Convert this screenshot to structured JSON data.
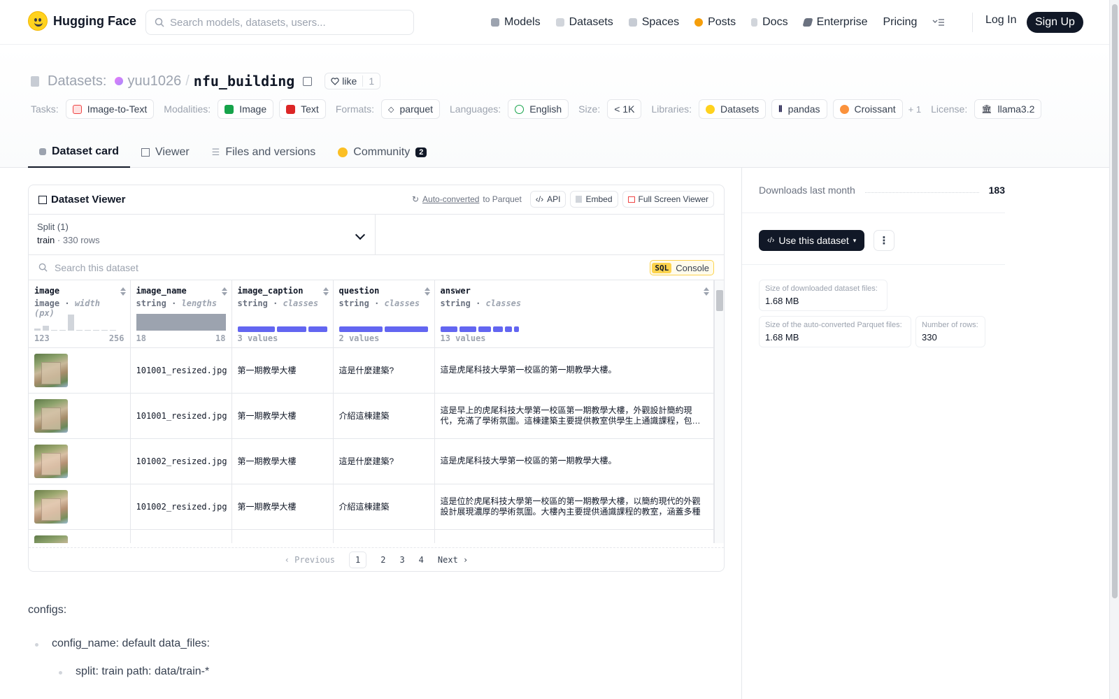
{
  "brand": {
    "name": "Hugging Face"
  },
  "search": {
    "placeholder": "Search models, datasets, users..."
  },
  "nav": {
    "items": [
      {
        "label": "Models",
        "color": "#9ca3af"
      },
      {
        "label": "Datasets",
        "color": "#d1d5db"
      },
      {
        "label": "Spaces",
        "color": "#c7ccd4"
      },
      {
        "label": "Posts",
        "color": "#f59e0b"
      },
      {
        "label": "Docs",
        "color": "#d1d5db"
      },
      {
        "label": "Enterprise",
        "color": "#6b7280"
      },
      {
        "label": "Pricing",
        "color": ""
      }
    ],
    "login": "Log In",
    "signup": "Sign Up"
  },
  "dataset": {
    "section": "Datasets:",
    "owner": "yuu1026",
    "separator": "/",
    "name": "nfu_building",
    "like_label": "like",
    "like_count": "1"
  },
  "tags": {
    "tasks_label": "Tasks:",
    "task": "Image-to-Text",
    "modalities_label": "Modalities:",
    "modality_image": "Image",
    "modality_text": "Text",
    "formats_label": "Formats:",
    "format": "parquet",
    "languages_label": "Languages:",
    "language": "English",
    "size_label": "Size:",
    "size": "< 1K",
    "libraries_label": "Libraries:",
    "lib1": "Datasets",
    "lib2": "pandas",
    "lib3": "Croissant",
    "lib_more": "+ 1",
    "license_label": "License:",
    "license": "llama3.2"
  },
  "tabs": [
    {
      "label": "Dataset card"
    },
    {
      "label": "Viewer"
    },
    {
      "label": "Files and versions"
    },
    {
      "label": "Community",
      "badge": "2"
    }
  ],
  "viewer": {
    "title": "Dataset Viewer",
    "auto_converted": "Auto-converted",
    "to_parquet": "to Parquet",
    "api": "API",
    "embed": "Embed",
    "fullscreen": "Full Screen Viewer",
    "split_label": "Split (1)",
    "split_name": "train",
    "split_dot": "·",
    "split_rows": "330 rows",
    "search_placeholder": "Search this dataset",
    "sql": "SQL",
    "console": "Console",
    "columns": [
      {
        "name": "image",
        "type": "image",
        "stat": "width (px)",
        "min": "123",
        "max": "256"
      },
      {
        "name": "image_name",
        "type": "string",
        "stat": "lengths",
        "min": "18",
        "max": "18"
      },
      {
        "name": "image_caption",
        "type": "string",
        "stat": "classes",
        "summary": "3 values"
      },
      {
        "name": "question",
        "type": "string",
        "stat": "classes",
        "summary": "2 values"
      },
      {
        "name": "answer",
        "type": "string",
        "stat": "classes",
        "summary": "13 values"
      }
    ],
    "histogram": [
      0.1,
      0.25,
      0,
      0.05,
      0.9,
      0.05,
      0.05,
      0.05,
      0,
      0.05
    ],
    "rows": [
      {
        "image_name": "101001_resized.jpg",
        "image_caption": "第一期教學大樓",
        "question": "這是什麼建築?",
        "answer": "這是虎尾科技大學第一校區的第一期教學大樓。"
      },
      {
        "image_name": "101001_resized.jpg",
        "image_caption": "第一期教學大樓",
        "question": "介紹這棟建築",
        "answer": "這是早上的虎尾科技大學第一校區第一期教學大樓，外觀設計簡約現代，充滿了學術氛圍。這棟建築主要提供教室供學生上通識課程，包含多種"
      },
      {
        "image_name": "101002_resized.jpg",
        "image_caption": "第一期教學大樓",
        "question": "這是什麼建築?",
        "answer": "這是虎尾科技大學第一校區的第一期教學大樓。"
      },
      {
        "image_name": "101002_resized.jpg",
        "image_caption": "第一期教學大樓",
        "question": "介紹這棟建築",
        "answer": "這是位於虎尾科技大學第一校區的第一期教學大樓，以簡約現代的外觀設計展現濃厚的學術氛圍。大樓內主要提供通識課程的教室，涵蓋多種"
      },
      {
        "image_name": "",
        "image_caption": "",
        "question": "",
        "answer": ""
      }
    ],
    "pager": {
      "prev": "Previous",
      "pages": [
        "1",
        "2",
        "3",
        "4"
      ],
      "next": "Next"
    }
  },
  "card": {
    "configs": "configs:",
    "item1": "config_name: default data_files:",
    "item2": "split: train path: data/train-*"
  },
  "sidebar": {
    "downloads_label": "Downloads last month",
    "downloads_value": "183",
    "use_button": "Use this dataset",
    "more": "⋮",
    "size_download_label": "Size of downloaded dataset files:",
    "size_download": "1.68 MB",
    "size_parquet_label": "Size of the auto-converted Parquet files:",
    "size_parquet": "1.68 MB",
    "rows_label": "Number of rows:",
    "rows": "330"
  }
}
